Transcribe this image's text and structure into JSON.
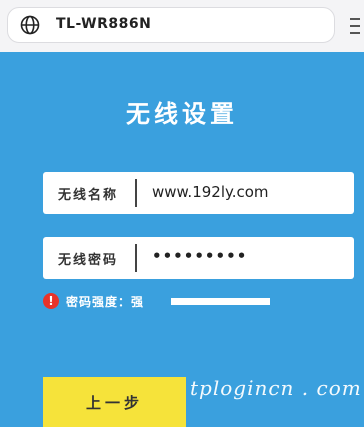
{
  "browser": {
    "address": "TL-WR886N",
    "icons": {
      "site": "globe-icon"
    }
  },
  "page": {
    "title": "无线设置",
    "ssid": {
      "label": "无线名称",
      "value": "www.192ly.com"
    },
    "password": {
      "label": "无线密码",
      "value": "•••••••••"
    },
    "strength": {
      "label": "密码强度：强",
      "icon": "warning-icon",
      "level": "strong",
      "colors": {
        "icon": "#e8332a",
        "bar": "#ffffff"
      }
    },
    "prev_button": "上一步"
  },
  "watermark": "tplogincn . com",
  "colors": {
    "background": "#3aa0de",
    "button": "#f6e33a"
  }
}
